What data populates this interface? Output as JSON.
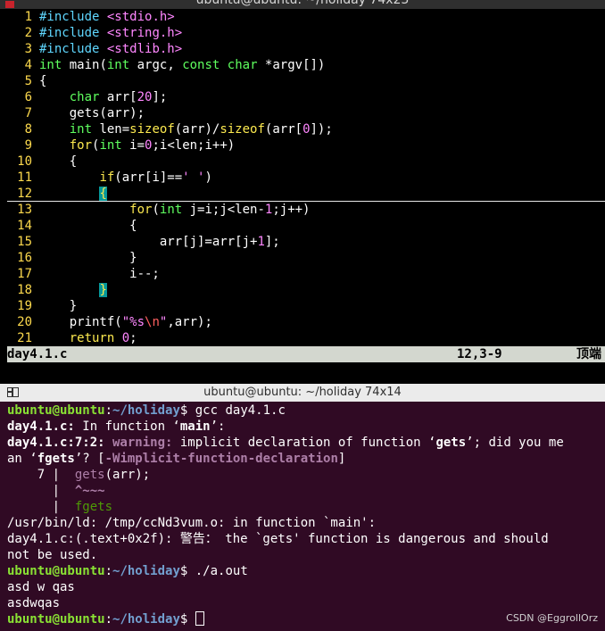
{
  "top_window": {
    "title": "ubuntu@ubuntu: ~/holiday 74x23"
  },
  "editor": {
    "lines": [
      {
        "n": "1"
      },
      {
        "n": "2"
      },
      {
        "n": "3"
      },
      {
        "n": "4"
      },
      {
        "n": "5"
      },
      {
        "n": "6"
      },
      {
        "n": "7"
      },
      {
        "n": "8"
      },
      {
        "n": "9"
      },
      {
        "n": "10"
      },
      {
        "n": "11"
      },
      {
        "n": "12"
      },
      {
        "n": "13"
      },
      {
        "n": "14"
      },
      {
        "n": "15"
      },
      {
        "n": "16"
      },
      {
        "n": "17"
      },
      {
        "n": "18"
      },
      {
        "n": "19"
      },
      {
        "n": "20"
      },
      {
        "n": "21"
      }
    ],
    "status_filename": "day4.1.c",
    "status_position": "12,3-9",
    "status_scroll": "顶端"
  },
  "bottom_window": {
    "title": "ubuntu@ubuntu: ~/holiday 74x14"
  },
  "terminal": {
    "prompt_user": "ubuntu@ubuntu",
    "prompt_colon": ":",
    "prompt_path": "~/holiday",
    "prompt_dollar": "$",
    "cmd1": " gcc day4.1.c",
    "l2_file": "day4.1.c:",
    "l2_rest": " In function ‘",
    "l2_fn": "main",
    "l2_end": "’:",
    "l3_loc": "day4.1.c:7:2:",
    "l3_warn": " warning:",
    "l3_msg1": " implicit declaration of function ‘",
    "l3_fn": "gets",
    "l3_msg2": "’; did you me",
    "l4_a": "an ‘",
    "l4_fn": "fgets",
    "l4_b": "’? [",
    "l4_flag": "-Wimplicit-function-declaration",
    "l4_c": "]",
    "l5_gutter": "    7 |  ",
    "l5_code": "gets",
    "l5_rest": "(arr);",
    "l6_gutter": "      |  ",
    "l6_carets": "^~~~",
    "l7_gutter": "      |  ",
    "l7_fix": "fgets",
    "l8": "/usr/bin/ld: /tmp/ccNd3vum.o: in function `main':",
    "l9": "day4.1.c:(.text+0x2f): 警告： the `gets' function is dangerous and should",
    "l10": "not be used.",
    "cmd2": " ./a.out",
    "l12": "asd w qas",
    "l13": "asdwqas",
    "cmd3": " "
  },
  "watermark": "CSDN @EggrollOrz"
}
